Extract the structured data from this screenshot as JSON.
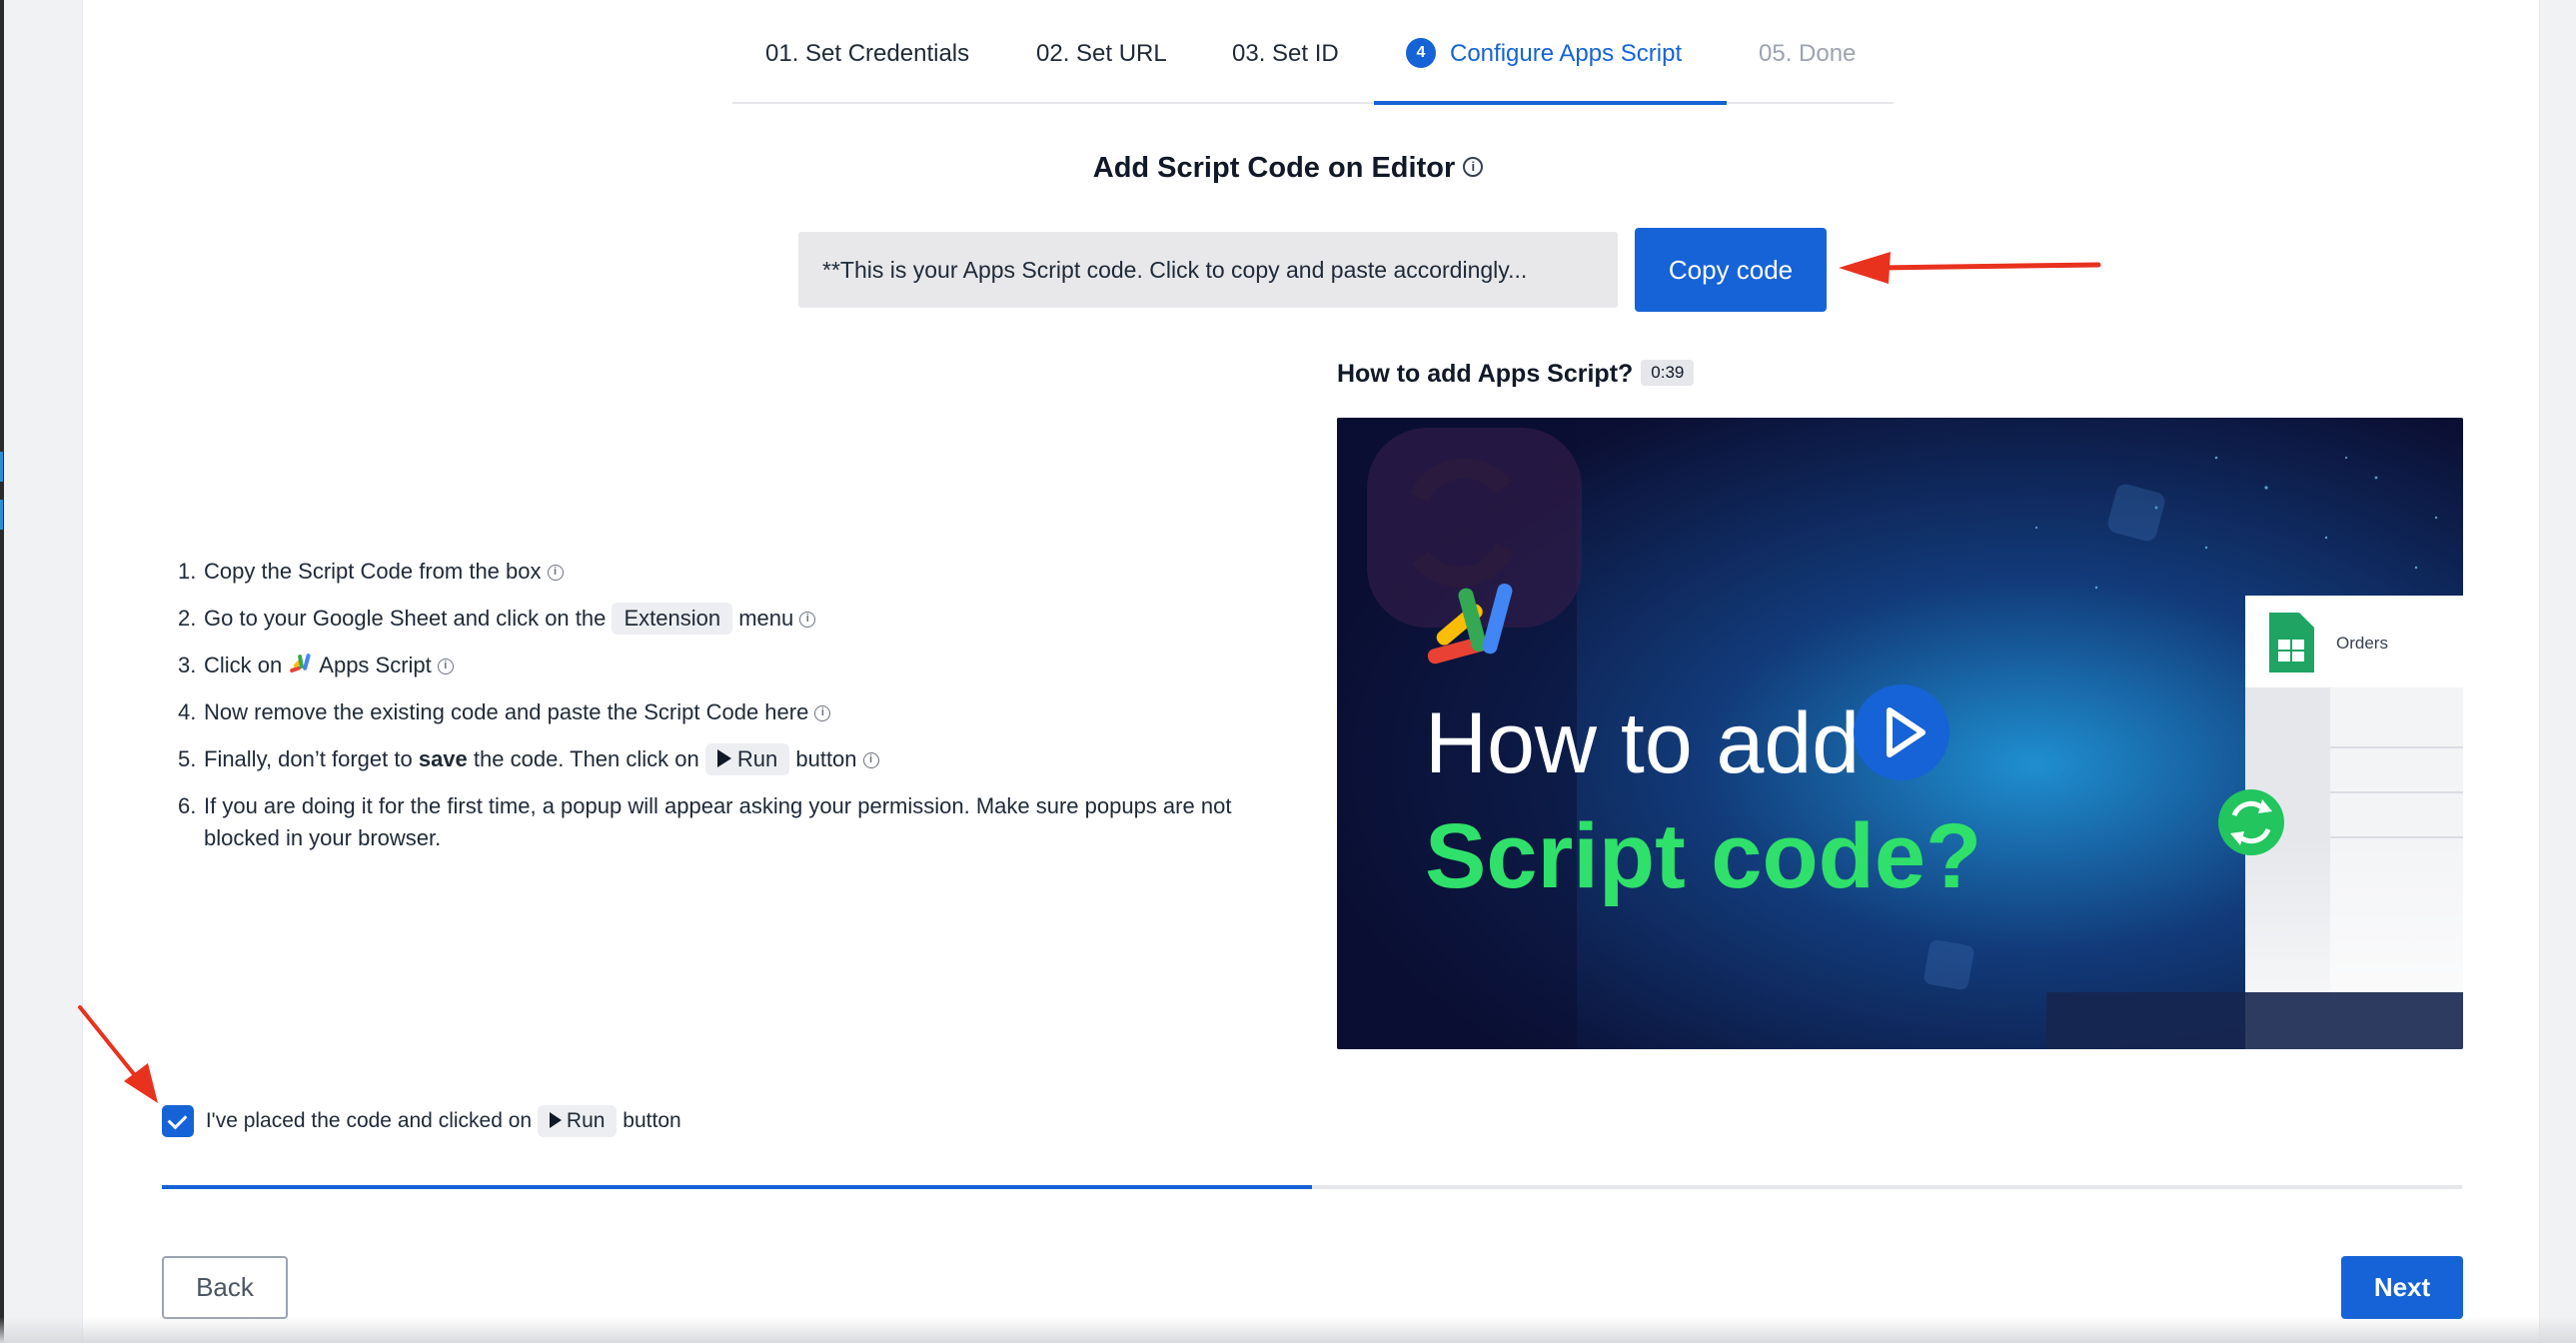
{
  "steps": [
    {
      "label": "01. Set Credentials"
    },
    {
      "label": "02. Set URL"
    },
    {
      "label": "03. Set ID"
    },
    {
      "num": "4",
      "label": "Configure Apps Script"
    },
    {
      "label": "05. Done"
    }
  ],
  "main": {
    "heading": "Add Script Code on Editor",
    "code_placeholder": "**This is your Apps Script code. Click to copy and paste accordingly...",
    "copy_button": "Copy code"
  },
  "instructions": [
    {
      "num": "1.",
      "text": "Copy the Script Code from the box"
    },
    {
      "num": "2.",
      "pre": "Go to your Google Sheet and click on the",
      "pill": "Extension",
      "post": "menu"
    },
    {
      "num": "3.",
      "pre": "Click on",
      "post": "Apps Script"
    },
    {
      "num": "4.",
      "text": "Now remove the existing code and paste the Script Code here"
    },
    {
      "num": "5.",
      "pre": "Finally, don’t forget to",
      "bold": "save",
      "mid": "the code. Then click on",
      "pill": "Run",
      "post": "button"
    },
    {
      "num": "6.",
      "text": "If you are doing it for the first time, a popup will appear asking your permission. Make sure popups are not blocked in your browser."
    }
  ],
  "video": {
    "title": "How to add Apps Script?",
    "duration": "0:39",
    "line1": "How to add",
    "line2": "Script code?",
    "sheet_label": "Orders"
  },
  "confirm": {
    "checked": true,
    "pre": "I've placed the code and clicked on",
    "pill": "Run",
    "post": "button"
  },
  "progress": {
    "fraction": 0.5
  },
  "nav": {
    "back": "Back",
    "next": "Next"
  },
  "colors": {
    "accent": "#1563d6",
    "annotation": "#e8321e",
    "video_green": "#2fe06a"
  }
}
